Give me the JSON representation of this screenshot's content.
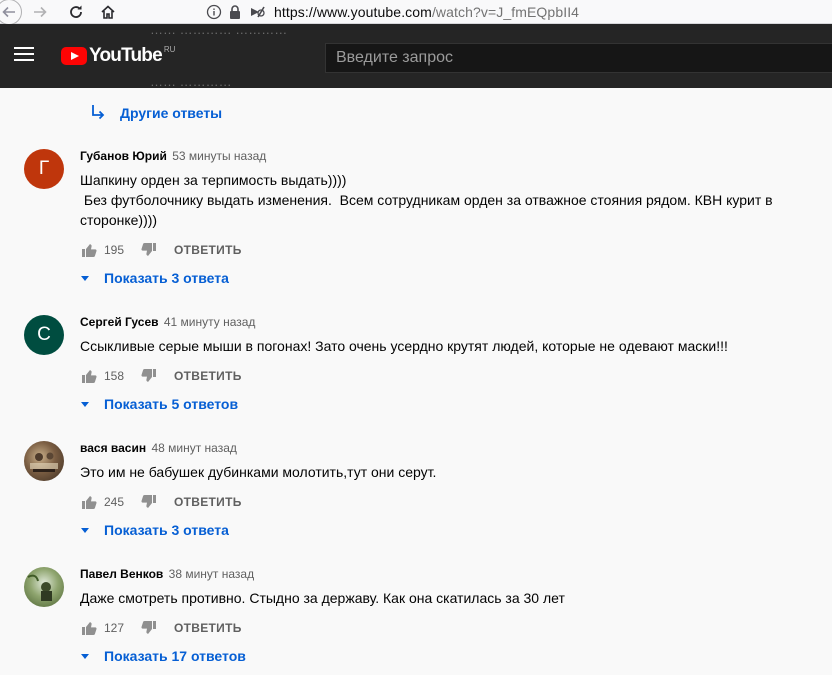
{
  "browser": {
    "url_host": "https://www.youtube.com",
    "url_path": "/watch?v=J_fmEQpbII4"
  },
  "header": {
    "logo_text": "YouTube",
    "logo_region": "RU",
    "search_placeholder": "Введите запрос",
    "ghost_text_top": "…… ………… …………",
    "ghost_text_bottom": "…… …………"
  },
  "more_replies_label": "Другие ответы",
  "comments": [
    {
      "author": "Губанов Юрий",
      "time": "53 минуты назад",
      "avatar_letter": "Г",
      "avatar_color": "#bf360c",
      "text": "Шапкину орден за терпимость выдать))))\n Без футболочнику выдать изменения.  Всем сотрудникам орден за отважное стояния рядом. КВН курит в сторонке))))",
      "likes": "195",
      "reply_label": "ОТВЕТИТЬ",
      "show_replies": "Показать 3 ответа"
    },
    {
      "author": "Сергей Гусев",
      "time": "41 минуту назад",
      "avatar_letter": "С",
      "avatar_color": "#004d40",
      "text": "Ссыкливые серые мыши в погонах! Зато очень усердно крутят людей, которые не одевают маски!!!",
      "likes": "158",
      "reply_label": "ОТВЕТИТЬ",
      "show_replies": "Показать 5 ответов"
    },
    {
      "author": "вася васин",
      "time": "48 минут назад",
      "avatar_letter": "",
      "avatar_color": "#6d5a48",
      "text": "Это им не бабушек дубинками молотить,тут они серут.",
      "likes": "245",
      "reply_label": "ОТВЕТИТЬ",
      "show_replies": "Показать 3 ответа"
    },
    {
      "author": "Павел Венков",
      "time": "38 минут назад",
      "avatar_letter": "",
      "avatar_color": "#6f8a4e",
      "text": "Даже смотреть противно. Стыдно за державу. Как она скатилась за 30 лет",
      "likes": "127",
      "reply_label": "ОТВЕТИТЬ",
      "show_replies": "Показать 17 ответов"
    }
  ]
}
